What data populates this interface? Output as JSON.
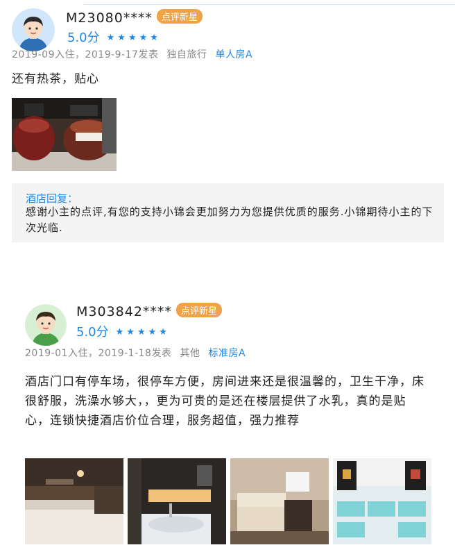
{
  "review1": {
    "username": "M23080****",
    "badge": "点评新星",
    "score": "5.0分",
    "stars": "★★★★★",
    "stay": "2019-09入住，2019-9-17发表",
    "trip": "独自旅行",
    "room": "单人房A",
    "content": "还有热茶，贴心",
    "reply_title": "酒店回复：",
    "reply_text": "感谢小主的点评,有您的支持小锦会更加努力为您提供优质的服务.小锦期待小主的下次光临."
  },
  "review2": {
    "username": "M303842****",
    "badge": "点评新星",
    "score": "5.0分",
    "stars": "★★★★★",
    "stay": "2019-01入住，2019-1-18发表",
    "trip": "其他",
    "room": "标准房A",
    "content": "酒店门口有停车场，很停车方便，房间进来还是很温馨的，卫生干净，床很舒服，洗澡水够大，，更为可贵的是还在楼层提供了水乳，真的是贴心，连锁快捷酒店价位合理，服务超值，强力推荐"
  },
  "colors": {
    "accent": "#1e88e5",
    "badge": "#f0a247",
    "reply_bg": "#f4f4f4"
  },
  "icons": [
    "avatar-female-icon",
    "avatar-male-icon",
    "star-icon"
  ]
}
